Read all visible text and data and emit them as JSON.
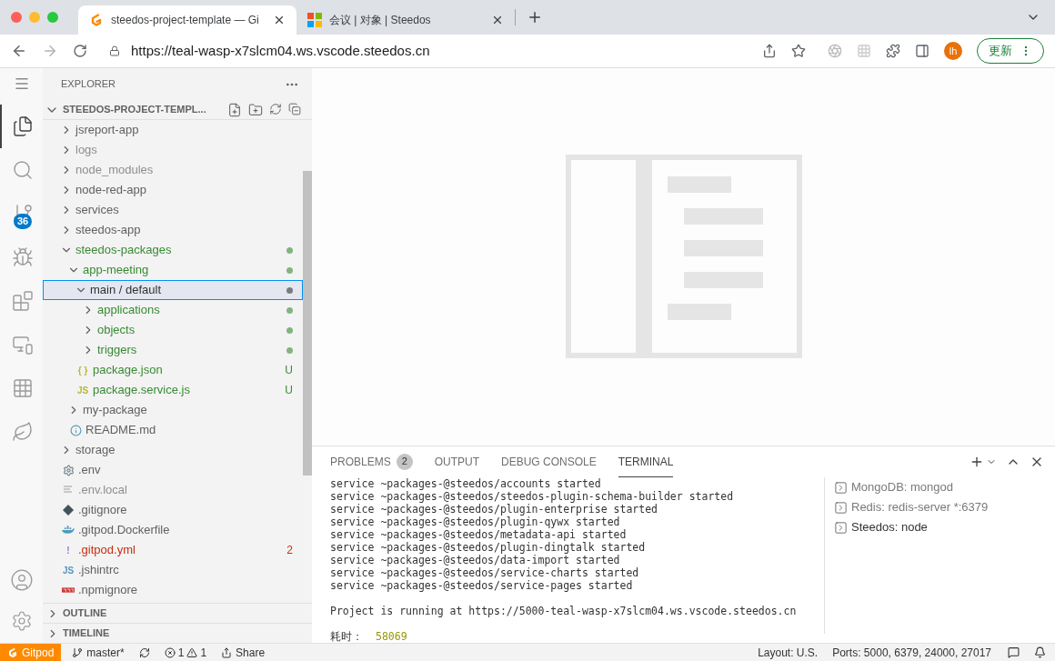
{
  "browser": {
    "tabs": [
      {
        "title": "steedos-project-template — Gi",
        "kind": "gitpod",
        "selected": true
      },
      {
        "title": "会议 | 对象 | Steedos",
        "kind": "steedos",
        "selected": false
      }
    ],
    "url": "https://teal-wasp-x7slcm04.ws.vscode.steedos.cn",
    "avatar": "lh",
    "update_button": "更新"
  },
  "activity_bar": {
    "items": [
      {
        "kind": "files",
        "selected": true
      },
      {
        "kind": "search",
        "selected": false
      },
      {
        "kind": "source-control",
        "selected": false,
        "badge": "36"
      },
      {
        "kind": "debug",
        "selected": false
      },
      {
        "kind": "extensions",
        "selected": false
      },
      {
        "kind": "remote",
        "selected": false
      },
      {
        "kind": "apps",
        "selected": false
      },
      {
        "kind": "leaf",
        "selected": false
      }
    ]
  },
  "sidebar": {
    "title": "EXPLORER",
    "root": {
      "label": "STEEDOS-PROJECT-TEMPL...",
      "expanded": true,
      "children": [
        {
          "label": "jsreport-app",
          "kind": "folder",
          "expanded": false,
          "color": "#616161",
          "selected": false
        },
        {
          "label": "logs",
          "kind": "folder",
          "expanded": false,
          "color": "#8e8e90",
          "selected": false
        },
        {
          "label": "node_modules",
          "kind": "folder",
          "expanded": false,
          "color": "#8e8e90",
          "selected": false
        },
        {
          "label": "node-red-app",
          "kind": "folder",
          "expanded": false,
          "color": "#616161",
          "selected": false
        },
        {
          "label": "services",
          "kind": "folder",
          "expanded": false,
          "color": "#616161",
          "selected": false
        },
        {
          "label": "steedos-app",
          "kind": "folder",
          "expanded": false,
          "color": "#616161",
          "selected": false
        },
        {
          "label": "steedos-packages",
          "kind": "folder",
          "expanded": true,
          "color": "#388a34",
          "dot": true,
          "selected": false,
          "children": [
            {
              "label": "app-meeting",
              "kind": "folder",
              "expanded": true,
              "color": "#388a34",
              "dot": true,
              "selected": false,
              "children": [
                {
                  "label": "main / default",
                  "kind": "folder",
                  "expanded": true,
                  "color": "#333333",
                  "dot": true,
                  "selected": true,
                  "children": [
                    {
                      "label": "applications",
                      "kind": "folder",
                      "expanded": false,
                      "color": "#388a34",
                      "dot": true,
                      "selected": false
                    },
                    {
                      "label": "objects",
                      "kind": "folder",
                      "expanded": false,
                      "color": "#388a34",
                      "dot": true,
                      "selected": false
                    },
                    {
                      "label": "triggers",
                      "kind": "folder",
                      "expanded": false,
                      "color": "#388a34",
                      "dot": true,
                      "selected": false
                    }
                  ]
                },
                {
                  "label": "package.json",
                  "kind": "json",
                  "icon_text": "{ }",
                  "color": "#388a34",
                  "badge": "U",
                  "selected": false
                },
                {
                  "label": "package.service.js",
                  "kind": "js",
                  "icon_text": "JS",
                  "color": "#388a34",
                  "badge": "U",
                  "selected": false
                }
              ]
            },
            {
              "label": "my-package",
              "kind": "folder",
              "expanded": false,
              "color": "#616161",
              "selected": false
            },
            {
              "label": "README.md",
              "kind": "info",
              "color": "#616161",
              "selected": false
            }
          ]
        },
        {
          "label": "storage",
          "kind": "folder",
          "expanded": false,
          "color": "#616161",
          "selected": false
        },
        {
          "label": ".env",
          "kind": "gear",
          "color": "#616161",
          "selected": false
        },
        {
          "label": ".env.local",
          "kind": "lines",
          "color": "#8e8e90",
          "selected": false
        },
        {
          "label": ".gitignore",
          "kind": "git",
          "color": "#616161",
          "selected": false
        },
        {
          "label": ".gitpod.Dockerfile",
          "kind": "docker",
          "color": "#616161",
          "selected": false
        },
        {
          "label": ".gitpod.yml",
          "kind": "yaml",
          "icon_text": "!",
          "color": "#c72e0f",
          "badge": "2",
          "selected": false
        },
        {
          "label": ".jshintrc",
          "kind": "jshint",
          "icon_text": "JS",
          "color": "#616161",
          "selected": false
        },
        {
          "label": ".npmignore",
          "kind": "npm",
          "color": "#616161",
          "selected": false
        }
      ]
    },
    "sections": [
      {
        "label": "OUTLINE",
        "expanded": false
      },
      {
        "label": "TIMELINE",
        "expanded": false
      }
    ]
  },
  "panel": {
    "tabs": [
      {
        "label": "PROBLEMS",
        "badge": "2",
        "selected": false
      },
      {
        "label": "OUTPUT",
        "selected": false
      },
      {
        "label": "DEBUG CONSOLE",
        "selected": false
      },
      {
        "label": "TERMINAL",
        "selected": true
      }
    ],
    "terminal_lines": [
      {
        "kind": "log",
        "text": "service ~packages-@steedos/accounts started"
      },
      {
        "kind": "log",
        "text": "service ~packages-@steedos/steedos-plugin-schema-builder started"
      },
      {
        "kind": "log",
        "text": "service ~packages-@steedos/plugin-enterprise started"
      },
      {
        "kind": "log",
        "text": "service ~packages-@steedos/plugin-qywx started"
      },
      {
        "kind": "log",
        "text": "service ~packages-@steedos/metadata-api started"
      },
      {
        "kind": "log",
        "text": "service ~packages-@steedos/plugin-dingtalk started"
      },
      {
        "kind": "log",
        "text": "service ~packages-@steedos/data-import started"
      },
      {
        "kind": "log",
        "text": "service ~packages-@steedos/service-charts started"
      },
      {
        "kind": "log",
        "text": "service ~packages-@steedos/service-pages started"
      },
      {
        "kind": "info",
        "text": "Project is running at https://5000-teal-wasp-x7slcm04.ws.vscode.steedos.cn"
      },
      {
        "kind": "timing",
        "label": "耗时：",
        "value": "58069"
      }
    ],
    "terminals": [
      {
        "label": "MongoDB: mongod",
        "selected": false
      },
      {
        "label": "Redis: redis-server *:6379",
        "selected": false
      },
      {
        "label": "Steedos: node",
        "selected": true
      }
    ]
  },
  "status_bar": {
    "remote": "Gitpod",
    "branch": "master*",
    "errors": "1",
    "warnings": "1",
    "share": "Share",
    "layout": "Layout: U.S.",
    "ports": "Ports: 5000, 6379, 24000, 27017"
  }
}
